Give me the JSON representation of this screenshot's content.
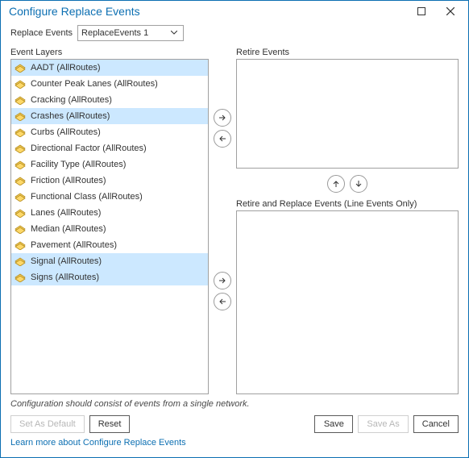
{
  "window": {
    "title": "Configure Replace Events"
  },
  "replace_events": {
    "label": "Replace Events",
    "selected": "ReplaceEvents 1"
  },
  "labels": {
    "event_layers": "Event Layers",
    "retire_events": "Retire Events",
    "retire_replace": "Retire and Replace Events (Line Events Only)"
  },
  "event_layers": [
    {
      "label": "AADT (AllRoutes)",
      "selected": true
    },
    {
      "label": "Counter Peak Lanes (AllRoutes)",
      "selected": false
    },
    {
      "label": "Cracking (AllRoutes)",
      "selected": false
    },
    {
      "label": "Crashes (AllRoutes)",
      "selected": true
    },
    {
      "label": "Curbs (AllRoutes)",
      "selected": false
    },
    {
      "label": "Directional Factor (AllRoutes)",
      "selected": false
    },
    {
      "label": "Facility Type (AllRoutes)",
      "selected": false
    },
    {
      "label": "Friction (AllRoutes)",
      "selected": false
    },
    {
      "label": "Functional Class (AllRoutes)",
      "selected": false
    },
    {
      "label": "Lanes (AllRoutes)",
      "selected": false
    },
    {
      "label": "Median (AllRoutes)",
      "selected": false
    },
    {
      "label": "Pavement (AllRoutes)",
      "selected": false
    },
    {
      "label": "Signal (AllRoutes)",
      "selected": true
    },
    {
      "label": "Signs (AllRoutes)",
      "selected": true
    }
  ],
  "retire_events": [],
  "retire_replace_events": [],
  "hint_text": "Configuration should consist of events from a single network.",
  "buttons": {
    "set_default": "Set As Default",
    "reset": "Reset",
    "save": "Save",
    "save_as": "Save As",
    "cancel": "Cancel"
  },
  "learn_more": "Learn more about Configure Replace Events",
  "colors": {
    "accent": "#0c6fb2",
    "selection": "#cce8ff"
  }
}
